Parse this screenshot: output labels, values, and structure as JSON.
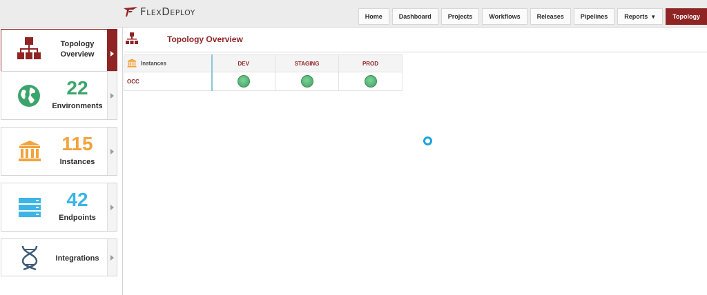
{
  "header": {
    "logo_text": "FlexDeploy",
    "nav": [
      {
        "label": "Home"
      },
      {
        "label": "Dashboard"
      },
      {
        "label": "Projects"
      },
      {
        "label": "Workflows"
      },
      {
        "label": "Releases"
      },
      {
        "label": "Pipelines"
      },
      {
        "label": "Reports",
        "has_dropdown": true
      },
      {
        "label": "Topology",
        "active": true
      }
    ]
  },
  "sidebar": {
    "cards": [
      {
        "label_line1": "Topology",
        "label_line2": "Overview",
        "active": true,
        "icon": "topology-icon"
      },
      {
        "count": "22",
        "label": "Environments",
        "color": "#3ba46b",
        "icon": "globe-icon"
      },
      {
        "count": "115",
        "label": "Instances",
        "color": "#f2a33a",
        "icon": "building-icon"
      },
      {
        "count": "42",
        "label": "Endpoints",
        "color": "#3cb4e6",
        "icon": "server-icon"
      },
      {
        "label": "Integrations",
        "icon": "dna-icon"
      }
    ]
  },
  "main": {
    "title": "Topology Overview",
    "table": {
      "instances_header": "Instances",
      "environments": [
        "DEV",
        "STAGING",
        "PROD"
      ],
      "rows": [
        {
          "name": "OCC",
          "statuses": [
            "green",
            "green",
            "green"
          ]
        }
      ]
    }
  },
  "colors": {
    "accent": "#8f2424",
    "status_ok": "#4caf6e",
    "spinner": "#1aa3dc"
  }
}
